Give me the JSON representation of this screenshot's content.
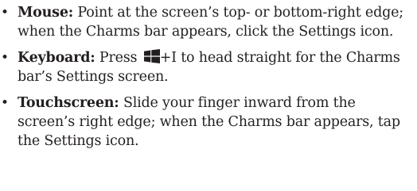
{
  "items": [
    {
      "term": "Mouse:",
      "text": " Point at the screen’s top- or bottom-right edge; when the Charms bar appears, click the Settings icon."
    },
    {
      "term": "Keyboard:",
      "text_before_icon": " Press ",
      "icon": "windows-logo-icon",
      "text_after_icon": "+I to head straight for the Charms bar’s Settings screen."
    },
    {
      "term": "Touchscreen:",
      "text": " Slide your finger inward from the screen’s right edge; when the Charms bar appears, tap the Settings icon."
    }
  ],
  "bullet": "•"
}
